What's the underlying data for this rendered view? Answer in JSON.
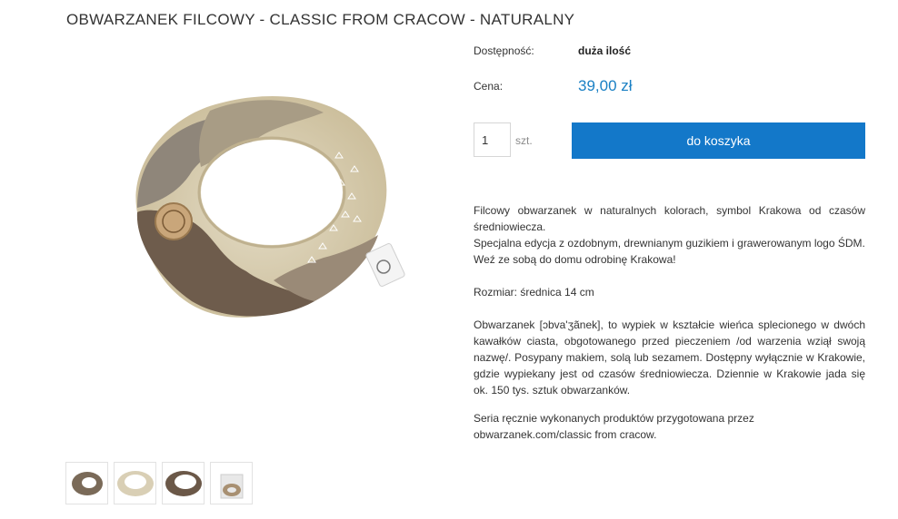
{
  "product": {
    "title": "OBWARZANEK FILCOWY - CLASSIC FROM CRACOW - NATURALNY",
    "availability_label": "Dostępność:",
    "availability_value": "duża ilość",
    "price_label": "Cena:",
    "price_value": "39,00 zł",
    "quantity_value": "1",
    "unit_label": "szt.",
    "add_to_cart_label": "do koszyka"
  },
  "description": {
    "p1": "Filcowy obwarzanek w naturalnych kolorach, symbol Krakowa od czasów średniowiecza.",
    "p2": "Specjalna edycja z ozdobnym, drewnianym guzikiem i grawerowanym logo ŚDM.",
    "p3": "Weź ze sobą do domu odrobinę Krakowa!",
    "p4": "Rozmiar: średnica 14 cm",
    "p5": "Obwarzanek [ɔbva'ʒãnek], to wypiek w kształcie wieńca splecionego w dwóch kawałków ciasta, obgotowanego przed pieczeniem /od warzenia wziął swoją nazwę/. Posypany makiem, solą lub sezamem. Dostępny wyłącznie w Krakowie, gdzie wypiekany jest od czasów średniowiecza. Dziennie w Krakowie jada się ok. 150 tys. sztuk obwarzanków.",
    "p6": "Seria ręcznie wykonanych produktów przygotowana przez obwarzanek.com/classic from cracow."
  },
  "colors": {
    "price": "#1a80c4",
    "button": "#1378c9"
  }
}
